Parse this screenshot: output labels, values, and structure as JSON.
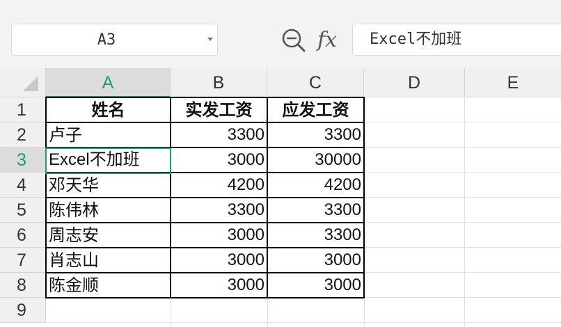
{
  "name_box": {
    "value": "A3"
  },
  "formula_bar": {
    "fx_label": "fx",
    "value": "Excel不加班"
  },
  "columns": [
    "A",
    "B",
    "C",
    "D",
    "E"
  ],
  "rows": [
    "1",
    "2",
    "3",
    "4",
    "5",
    "6",
    "7",
    "8",
    "9"
  ],
  "selection": {
    "column": "A",
    "row": "3",
    "cell": "A3"
  },
  "table": {
    "headers": [
      "姓名",
      "实发工资",
      "应发工资"
    ],
    "rows": [
      {
        "name": "卢子",
        "actual": "3300",
        "due": "3300"
      },
      {
        "name": "Excel不加班",
        "actual": "3000",
        "due": "30000"
      },
      {
        "name": "邓天华",
        "actual": "4200",
        "due": "4200"
      },
      {
        "name": "陈伟林",
        "actual": "3300",
        "due": "3300"
      },
      {
        "name": "周志安",
        "actual": "3000",
        "due": "3300"
      },
      {
        "name": "肖志山",
        "actual": "3000",
        "due": "3000"
      },
      {
        "name": "陈金顺",
        "actual": "3000",
        "due": "3000"
      }
    ]
  },
  "colors": {
    "accent": "#1f9e6a",
    "header_bg": "#f0f0f0",
    "selected_header_bg": "#dcdcdc"
  },
  "icons": {
    "zoom": "zoom-out-icon",
    "dropdown": "chevron-down-icon"
  }
}
